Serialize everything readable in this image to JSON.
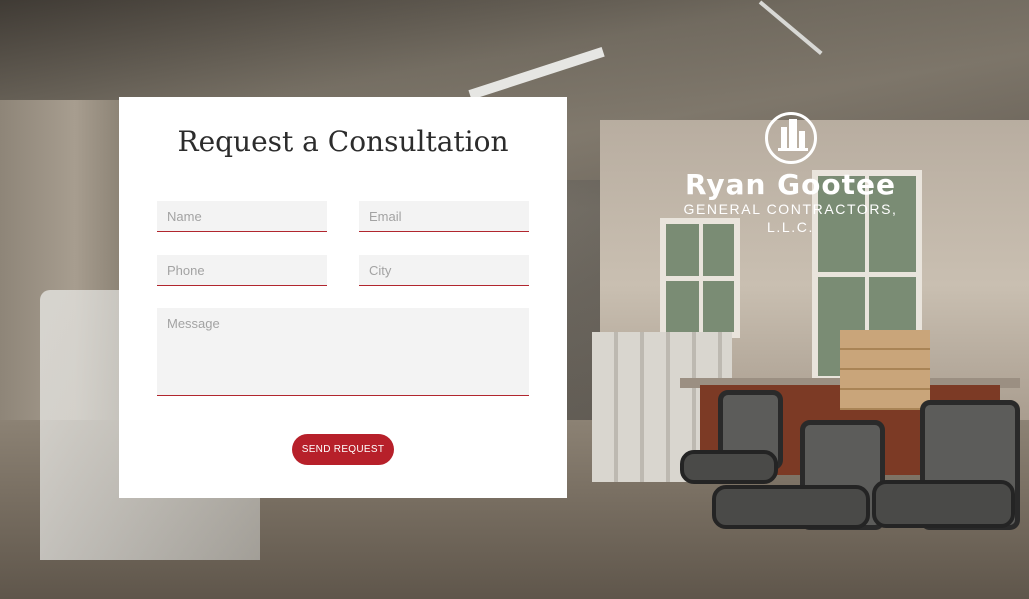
{
  "form": {
    "title": "Request a Consultation",
    "fields": {
      "name_placeholder": "Name",
      "email_placeholder": "Email",
      "phone_placeholder": "Phone",
      "city_placeholder": "City",
      "message_placeholder": "Message"
    },
    "submit_label": "SEND REQUEST"
  },
  "logo": {
    "name": "Ryan Gootee",
    "subtitle": "GENERAL CONTRACTORS, L.L.C."
  },
  "colors": {
    "accent": "#b7202a",
    "card_background": "#ffffff",
    "field_background": "#f3f3f3"
  }
}
